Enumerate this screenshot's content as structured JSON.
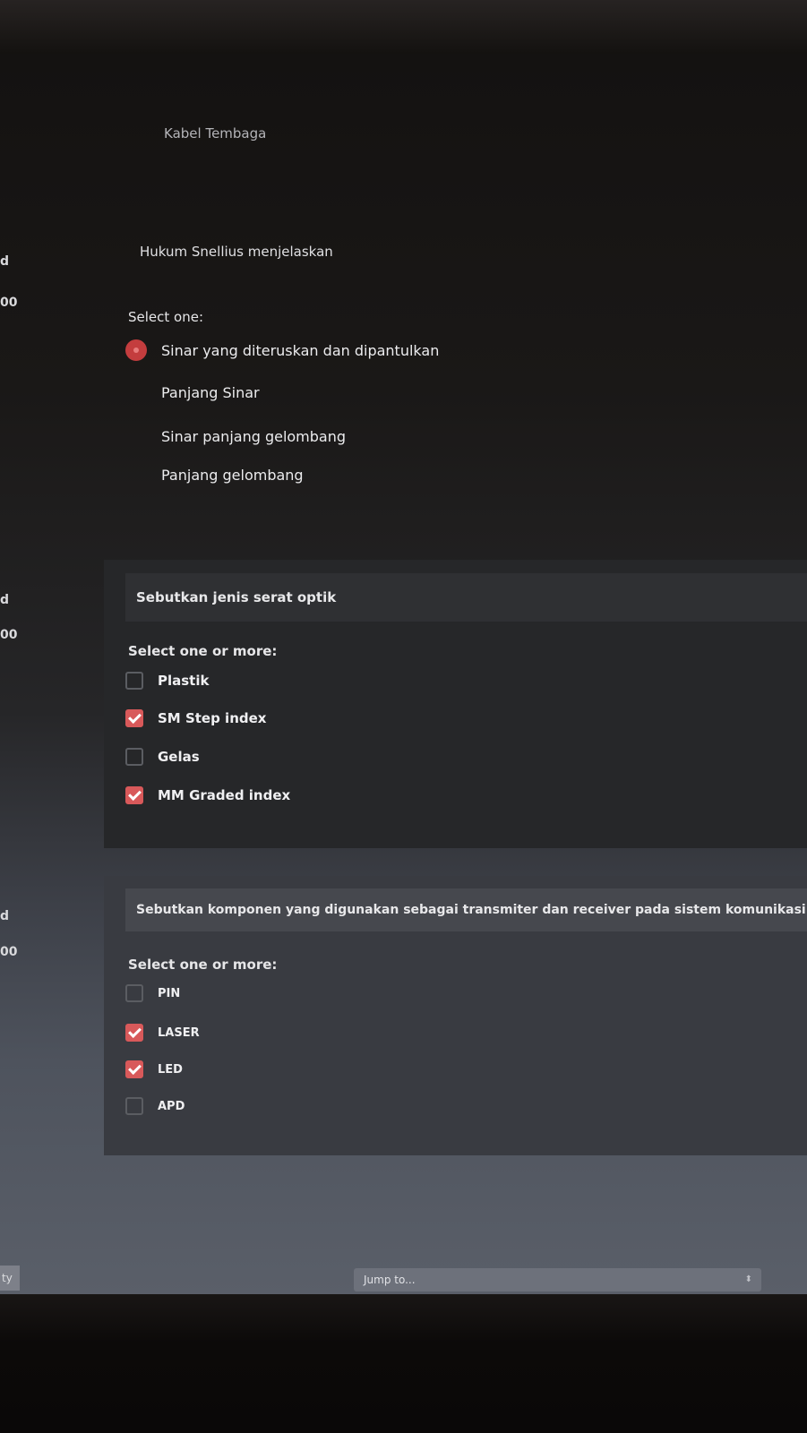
{
  "previous_answer": {
    "text": "Kabel Tembaga"
  },
  "gutter": {
    "q1_mark": "d",
    "q1_points": "00",
    "q2_mark": "d",
    "q2_points": "00",
    "q3_mark": "d",
    "q3_points": "00"
  },
  "question1": {
    "text": "Hukum Snellius menjelaskan",
    "prompt": "Select one:",
    "options": [
      {
        "label": "Sinar yang diteruskan dan dipantulkan",
        "selected": true
      },
      {
        "label": "Panjang Sinar",
        "selected": false
      },
      {
        "label": "Sinar panjang gelombang",
        "selected": false
      },
      {
        "label": "Panjang gelombang",
        "selected": false
      }
    ]
  },
  "question2": {
    "text": "Sebutkan jenis serat optik",
    "prompt": "Select one or more:",
    "options": [
      {
        "label": "Plastik",
        "checked": false
      },
      {
        "label": "SM Step index",
        "checked": true
      },
      {
        "label": "Gelas",
        "checked": false
      },
      {
        "label": "MM Graded index",
        "checked": true
      }
    ]
  },
  "question3": {
    "text": "Sebutkan komponen yang digunakan sebagai transmiter dan receiver pada sistem komunikasi o",
    "prompt": "Select one or more:",
    "options": [
      {
        "label": "PIN",
        "checked": false
      },
      {
        "label": "LASER",
        "checked": true
      },
      {
        "label": "LED",
        "checked": true
      },
      {
        "label": "APD",
        "checked": false
      }
    ]
  },
  "footer": {
    "left_link": "ty",
    "jump_placeholder": "Jump to...",
    "jump_caret": "⬍"
  },
  "colors": {
    "accent": "#d8595a",
    "card_dark": "#262729",
    "card_light": "#393b41"
  }
}
